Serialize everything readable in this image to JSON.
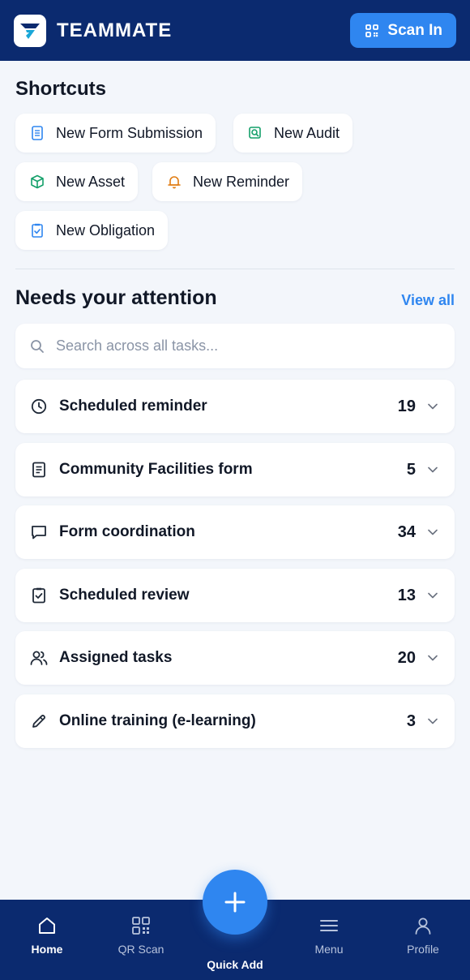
{
  "header": {
    "brand": "TEAMMATE",
    "scan_label": "Scan In"
  },
  "shortcuts": {
    "title": "Shortcuts",
    "items": [
      {
        "label": "New Form Submission",
        "icon": "document-icon",
        "color": "#2f86f0"
      },
      {
        "label": "New Audit",
        "icon": "audit-search-icon",
        "color": "#14a06a"
      },
      {
        "label": "New Asset",
        "icon": "box-icon",
        "color": "#14a06a"
      },
      {
        "label": "New Reminder",
        "icon": "bell-icon",
        "color": "#e07b10"
      },
      {
        "label": "New Obligation",
        "icon": "clipboard-check-icon",
        "color": "#2f86f0"
      }
    ]
  },
  "attention": {
    "title": "Needs your attention",
    "view_all": "View all",
    "search_placeholder": "Search across all tasks...",
    "tasks": [
      {
        "label": "Scheduled reminder",
        "count": "19",
        "icon": "clock-icon"
      },
      {
        "label": "Community Facilities form",
        "count": "5",
        "icon": "form-icon"
      },
      {
        "label": "Form coordination",
        "count": "34",
        "icon": "chat-icon"
      },
      {
        "label": "Scheduled review",
        "count": "13",
        "icon": "clipboard-check-icon"
      },
      {
        "label": "Assigned tasks",
        "count": "20",
        "icon": "users-icon"
      },
      {
        "label": "Online training (e-learning)",
        "count": "3",
        "icon": "pencil-icon"
      }
    ]
  },
  "nav": {
    "home": "Home",
    "qr_scan": "QR Scan",
    "quick_add": "Quick Add",
    "menu": "Menu",
    "profile": "Profile"
  },
  "colors": {
    "header_bg": "#0b2a6f",
    "accent": "#2f86f0",
    "page_bg": "#f3f6fb"
  }
}
